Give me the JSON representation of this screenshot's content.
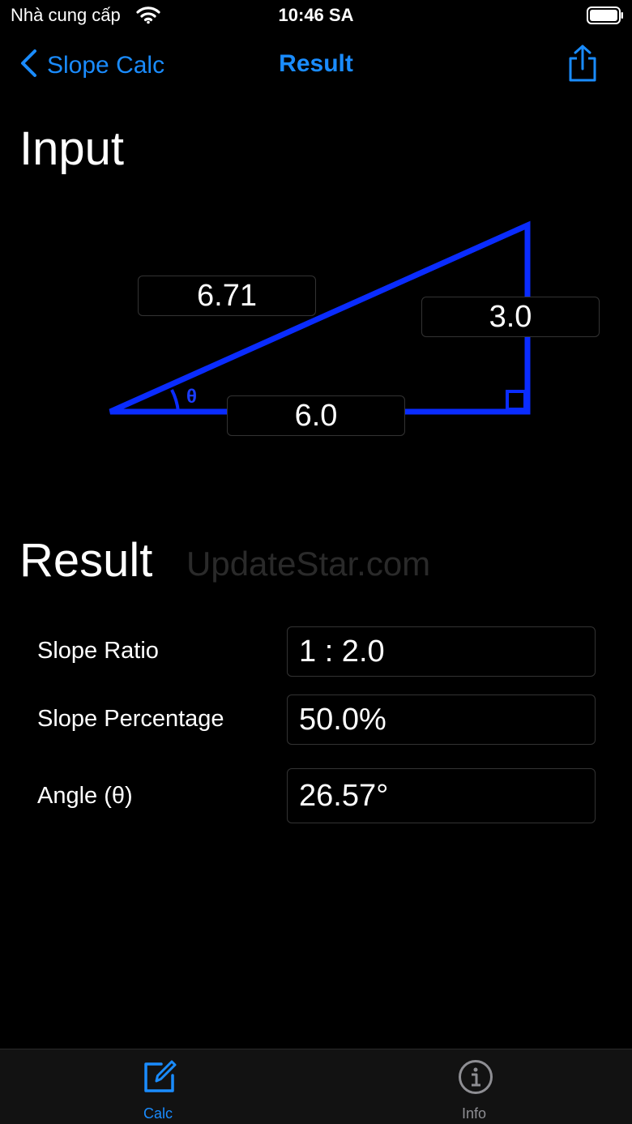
{
  "status_bar": {
    "carrier": "Nhà cung cấp",
    "time": "10:46 SA"
  },
  "nav": {
    "back_label": "Slope Calc",
    "title": "Result",
    "share_icon": "share-icon"
  },
  "input_section": {
    "title": "Input",
    "hypotenuse": "6.71",
    "height": "3.0",
    "base": "6.0",
    "angle_symbol": "θ"
  },
  "result_section": {
    "title": "Result",
    "watermark": "UpdateStar.com",
    "rows": [
      {
        "label": "Slope Ratio",
        "value": "1 : 2.0"
      },
      {
        "label": "Slope Percentage",
        "value": "50.0%"
      },
      {
        "label": "Angle (θ)",
        "value": "26.57°"
      }
    ]
  },
  "tab_bar": {
    "tabs": [
      {
        "label": "Calc",
        "icon": "edit-icon",
        "selected": true
      },
      {
        "label": "Info",
        "icon": "info-icon",
        "selected": false
      }
    ]
  },
  "colors": {
    "accent": "#1a8cff",
    "triangle": "#0a2cff",
    "background": "#000000"
  }
}
